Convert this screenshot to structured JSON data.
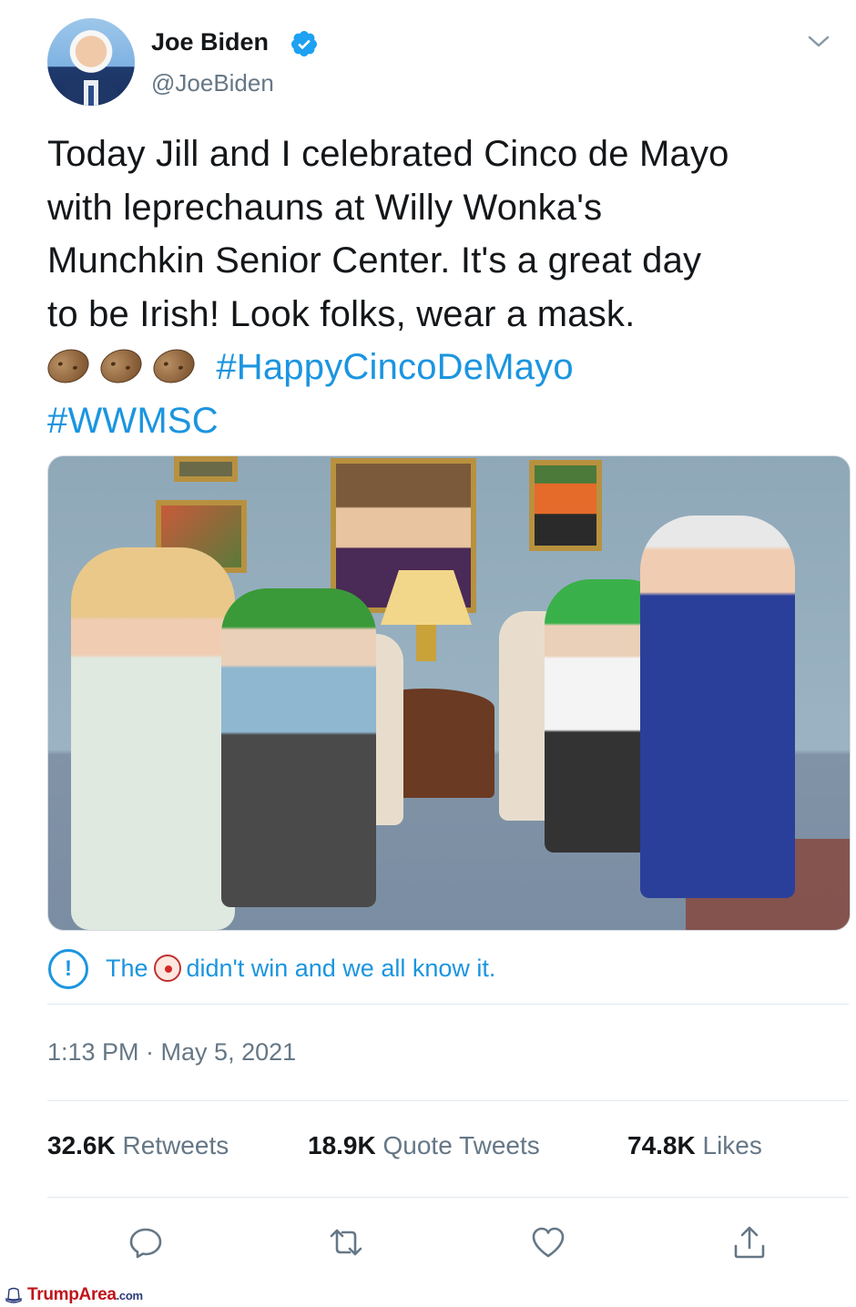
{
  "author": {
    "name": "Joe Biden",
    "handle": "@JoeBiden",
    "verified": true
  },
  "tweet": {
    "lines": [
      "Today Jill and I celebrated Cinco de Mayo",
      "with leprechauns at Willy Wonka's",
      "Munchkin Senior Center. It's a great day",
      "to be Irish! Look folks, wear a mask."
    ],
    "hashtags": [
      "#HappyCincoDeMayo",
      "#WWMSC"
    ],
    "emojis": [
      "potato-icon",
      "potato-icon",
      "potato-icon"
    ]
  },
  "notice": {
    "prefix": "The",
    "suffix": "didn't win and we all know it.",
    "icon": "exclamation-circle-icon",
    "emoji": "clown-face-icon"
  },
  "timestamp": "1:13 PM · May 5, 2021",
  "stats": {
    "retweets_count": "32.6K",
    "retweets_label": "Retweets",
    "quotes_count": "18.9K",
    "quotes_label": "Quote Tweets",
    "likes_count": "74.8K",
    "likes_label": "Likes"
  },
  "actions": [
    "reply-icon",
    "retweet-icon",
    "like-icon",
    "share-icon"
  ],
  "watermark": {
    "brand": "TrumpArea",
    "domain": ".com"
  },
  "colors": {
    "link": "#1b95e0",
    "secondary_text": "#657786",
    "primary_text": "#14171a",
    "watermark_red": "#c0141b"
  }
}
